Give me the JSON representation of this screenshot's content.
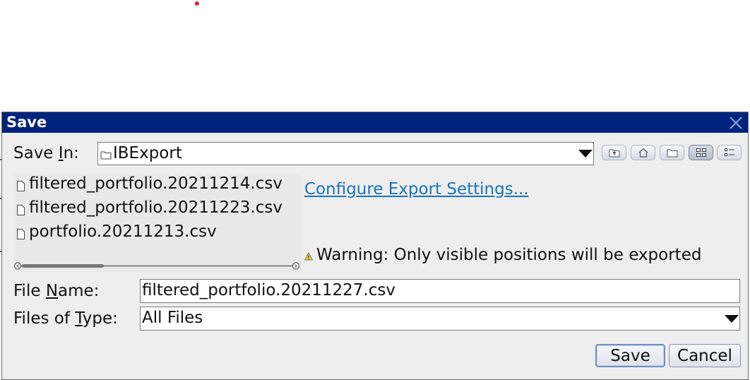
{
  "dialog": {
    "title": "Save",
    "save_in": {
      "label_pre": "Save ",
      "label_mnemonic": "I",
      "label_post": "n:",
      "value": "IBExport"
    },
    "files": [
      {
        "name": "filtered_portfolio.20211214.csv"
      },
      {
        "name": "filtered_portfolio.20211223.csv"
      },
      {
        "name": "portfolio.20211213.csv"
      }
    ],
    "configure_link": "Configure Export Settings...",
    "warning": "Warning: Only visible positions will be exported",
    "file_name": {
      "label_pre": "File ",
      "label_mnemonic": "N",
      "label_post": "ame:",
      "value": "filtered_portfolio.20211227.csv"
    },
    "files_of_type": {
      "label_pre": "Files of ",
      "label_mnemonic": "T",
      "label_post": "ype:",
      "value": "All Files"
    },
    "buttons": {
      "save": "Save",
      "cancel": "Cancel"
    },
    "toolbar_icons": [
      "up-folder-icon",
      "home-icon",
      "new-folder-icon",
      "list-view-icon",
      "details-view-icon"
    ],
    "active_view": "list-view"
  },
  "colors": {
    "titlebar": "#00247d",
    "dialog_bg": "#eeeeee",
    "link": "#1a73b8"
  }
}
